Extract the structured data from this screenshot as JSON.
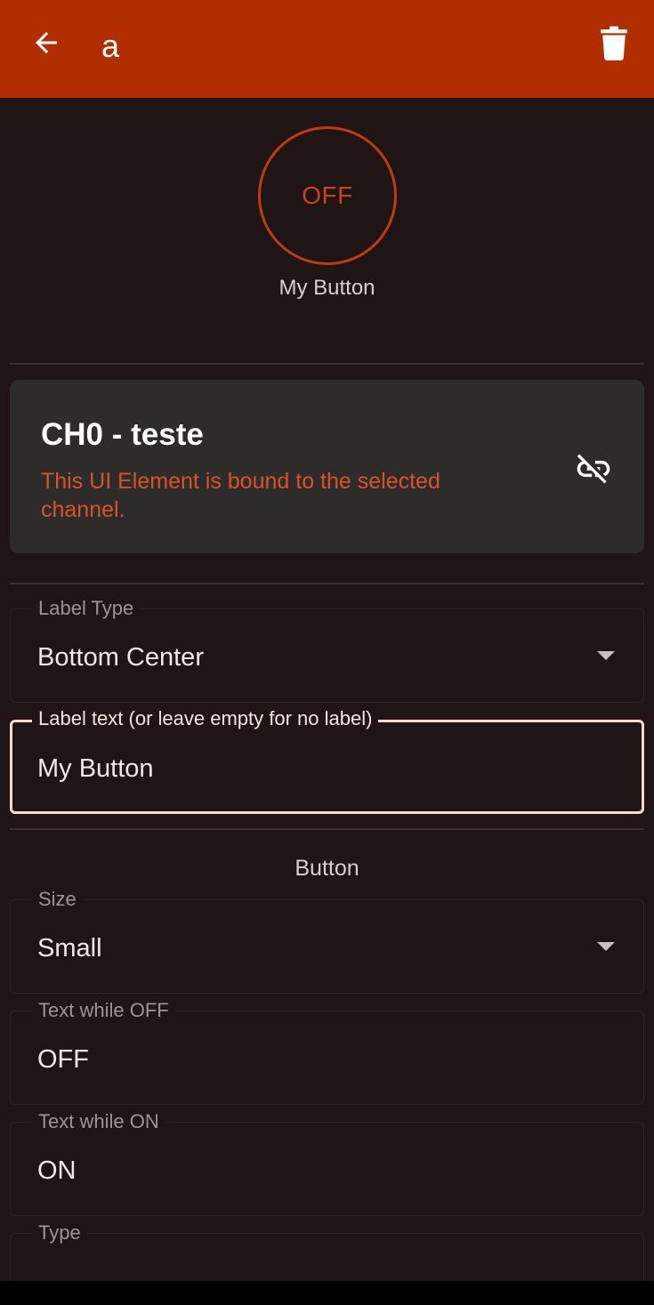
{
  "appbar": {
    "title": "a",
    "back_icon": "arrow-left-icon",
    "delete_icon": "trash-icon",
    "color": "#b02e00"
  },
  "preview": {
    "button_text": "OFF",
    "label": "My Button",
    "accent_color": "#c23a12"
  },
  "channel": {
    "title": "CH0 - teste",
    "description": "This UI Element is bound to the selected channel.",
    "unlink_icon": "link-off-icon"
  },
  "label_type": {
    "label": "Label Type",
    "value": "Bottom Center"
  },
  "label_text": {
    "label": "Label text (or leave empty for no label)",
    "value": "My Button"
  },
  "button_section": {
    "title": "Button",
    "size": {
      "label": "Size",
      "value": "Small"
    },
    "text_off": {
      "label": "Text while OFF",
      "value": "OFF"
    },
    "text_on": {
      "label": "Text while ON",
      "value": "ON"
    },
    "type": {
      "label": "Type"
    }
  }
}
